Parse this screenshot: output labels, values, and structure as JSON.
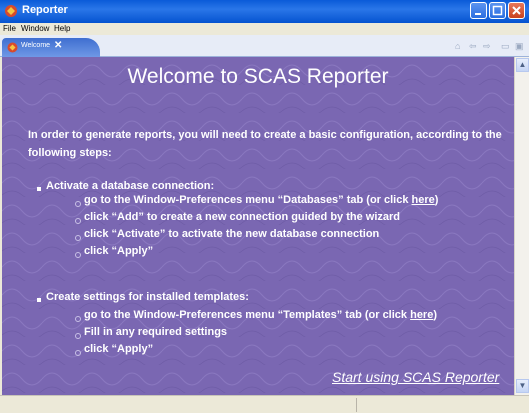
{
  "window": {
    "title": "Reporter"
  },
  "menu": [
    "File",
    "Window",
    "Help"
  ],
  "tab": {
    "label": "Welcome",
    "close": "✕"
  },
  "toolbar_icons": [
    "home-icon",
    "back-icon",
    "forward-icon",
    "minimize-view-icon",
    "maximize-view-icon"
  ],
  "welcome": {
    "title": "Welcome to SCAS Reporter",
    "intro": "In order to generate reports, you will need to create a basic configuration, according to the following steps:",
    "section1": {
      "heading": "Activate a database connection:",
      "step1_text": "go to the Window-Preferences menu “Databases” tab (or click ",
      "step1_link": "here",
      "step1_end": ")",
      "step2": "click “Add” to create a new connection guided by the wizard",
      "step3": "click “Activate” to activate the new database connection",
      "step4": "click “Apply”"
    },
    "section2": {
      "heading": "Create settings for installed templates:",
      "step1_text": "go to the Window-Preferences menu “Templates” tab (or click ",
      "step1_link": "here",
      "step1_end": ")",
      "step2": "Fill in any required settings",
      "step3": "click “Apply”"
    },
    "start_link": "Start using SCAS Reporter"
  },
  "colors": {
    "content_bg": "#7a67b2",
    "title_bar": "#0a5bd8",
    "tab": "#3f6fd0"
  }
}
